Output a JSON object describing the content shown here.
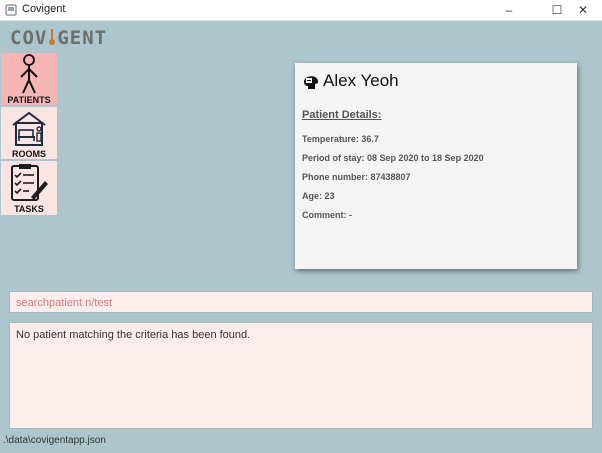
{
  "window": {
    "title": "Covigent",
    "minimize": "–",
    "maximize": "☐",
    "close": "✕"
  },
  "logo": {
    "text_left": "COV",
    "text_right": "GENT"
  },
  "nav": [
    {
      "label": "PATIENTS",
      "icon": "stick-figure-icon",
      "active": true
    },
    {
      "label": "ROOMS",
      "icon": "bedroom-icon",
      "active": false
    },
    {
      "label": "TASKS",
      "icon": "checklist-icon",
      "active": false
    }
  ],
  "patient": {
    "name": "Alex Yeoh",
    "details_heading": "Patient Details:",
    "temperature": "Temperature: 36.7",
    "period": "Period of stay: 08 Sep 2020 to 18 Sep 2020",
    "phone": "Phone number: 87438807",
    "age": "Age: 23",
    "comment": "Comment: -"
  },
  "command": {
    "value": "searchpatient n/test"
  },
  "result": {
    "text": "No patient matching the criteria has been found."
  },
  "status": {
    "path": ".\\data\\covigentapp.json"
  },
  "colors": {
    "background": "#adc5cc",
    "nav_active": "#f5b5b5",
    "nav_inactive": "#fbe4e4",
    "input_bg": "#fcecec",
    "command_text": "#d27d7d"
  }
}
